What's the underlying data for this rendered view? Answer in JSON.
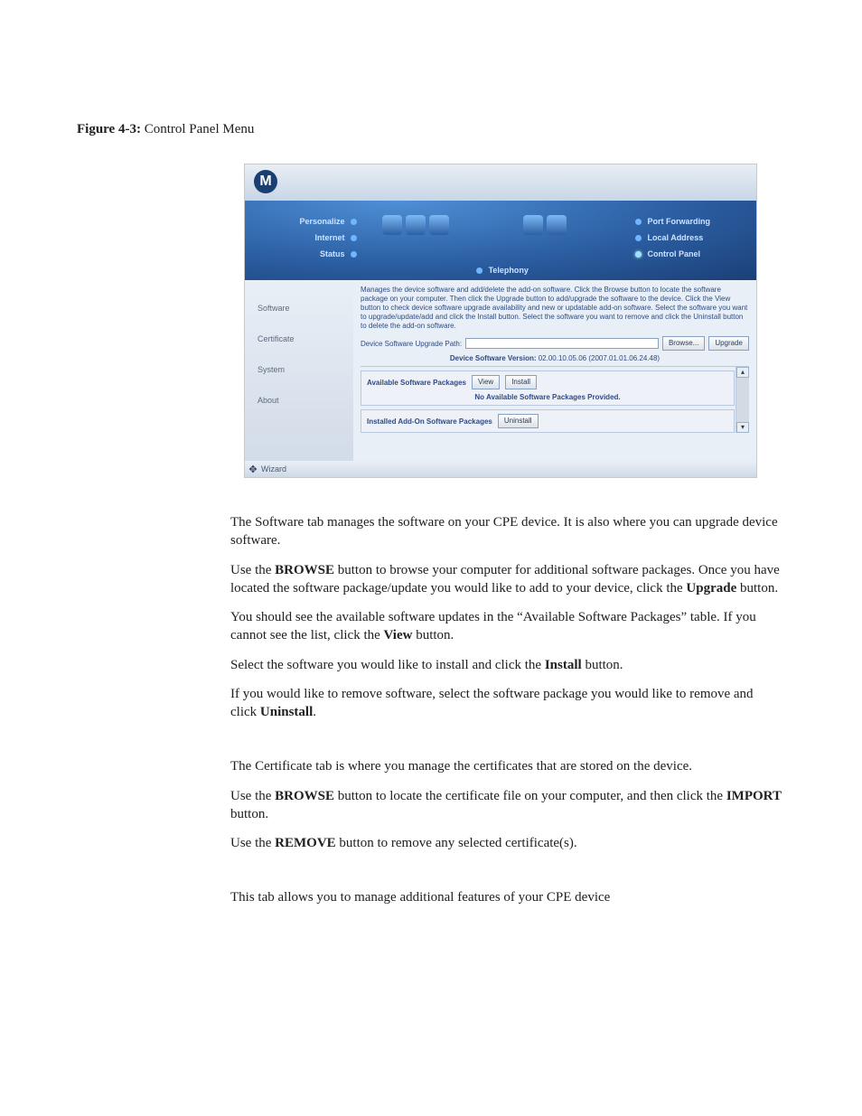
{
  "figure": {
    "label": "Figure 4-3:",
    "title": " Control Panel Menu"
  },
  "nav": {
    "left": [
      "Personalize",
      "Internet",
      "Status"
    ],
    "center": "Telephony",
    "right": [
      "Port Forwarding",
      "Local Address",
      "Control Panel"
    ]
  },
  "sidebar": {
    "items": [
      "Software",
      "Certificate",
      "System",
      "About"
    ]
  },
  "main": {
    "description": "Manages the device software and add/delete the add-on software. Click the Browse button to locate the software package on your computer. Then click the Upgrade button to add/upgrade the software to the device. Click the View button to check device software upgrade availability and new or updatable add-on software. Select the software you want to upgrade/update/add and click the Install button. Select the software you want to remove and click the Uninstall button to delete the add-on software.",
    "upgrade_path_label": "Device Software Upgrade Path:",
    "upgrade_path_value": "",
    "browse_btn": "Browse...",
    "upgrade_btn": "Upgrade",
    "version_label": "Device Software Version:",
    "version_value": "02.00.10.05.06 (2007.01.01.06.24.48)",
    "available_title": "Available Software Packages",
    "view_btn": "View",
    "install_btn": "Install",
    "available_msg": "No Available Software Packages Provided.",
    "installed_title": "Installed Add-On Software Packages",
    "uninstall_btn": "Uninstall"
  },
  "footer": {
    "wizard": "Wizard"
  },
  "prose": {
    "p1a": "The Software tab manages the software on your CPE device. It is also where you can upgrade device software.",
    "p2a": "Use the ",
    "p2b": "BROWSE",
    "p2c": " button to browse your computer for additional software packages. Once you have located the software package/update you would like to add to your device, click the ",
    "p2d": "Upgrade",
    "p2e": " button.",
    "p3a": "You should see the available software updates in the “Available Software Packages” table. If you cannot see the list, click the ",
    "p3b": "View",
    "p3c": " button.",
    "p4a": "Select the software you would like to install and click the ",
    "p4b": "Install",
    "p4c": " button.",
    "p5a": "If you would like to remove software, select the software package you would like to remove and click ",
    "p5b": "Uninstall",
    "p5c": ".",
    "p6": "The Certificate tab is where you manage the certificates that are stored on the device.",
    "p7a": "Use the ",
    "p7b": "BROWSE",
    "p7c": " button to locate the certificate file on your computer, and then click the ",
    "p7d": "IMPORT",
    "p7e": " button.",
    "p8a": "Use the ",
    "p8b": "REMOVE",
    "p8c": " button to remove any selected certificate(s).",
    "p9": "This tab allows you to manage additional features of your CPE device"
  }
}
